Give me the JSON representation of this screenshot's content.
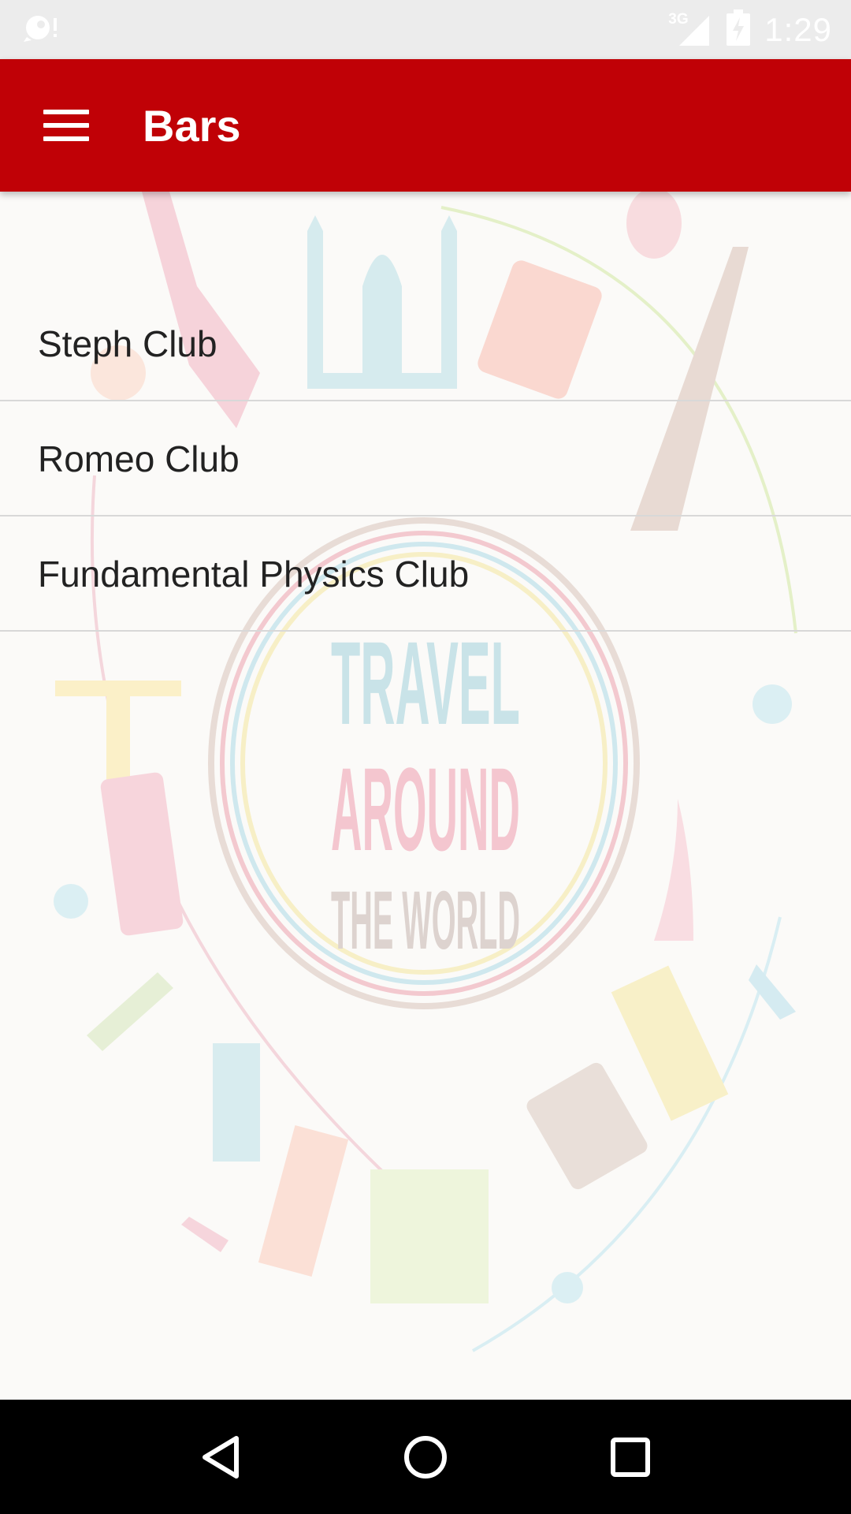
{
  "status_bar": {
    "time": "1:29",
    "network": "3G",
    "icons": [
      "app-notification-icon",
      "signal-icon",
      "battery-charging-icon"
    ]
  },
  "app_bar": {
    "title": "Bars",
    "menu_icon": "hamburger-menu-icon",
    "color": "#c00106"
  },
  "background": {
    "line1": "TRAVEL",
    "line2": "AROUND",
    "line3": "THE WORLD"
  },
  "list": {
    "items": [
      {
        "label": "Steph Club"
      },
      {
        "label": "Romeo Club"
      },
      {
        "label": "Fundamental Physics Club"
      }
    ]
  },
  "nav_bar": {
    "icons": [
      "back-icon",
      "home-icon",
      "recents-icon"
    ]
  }
}
